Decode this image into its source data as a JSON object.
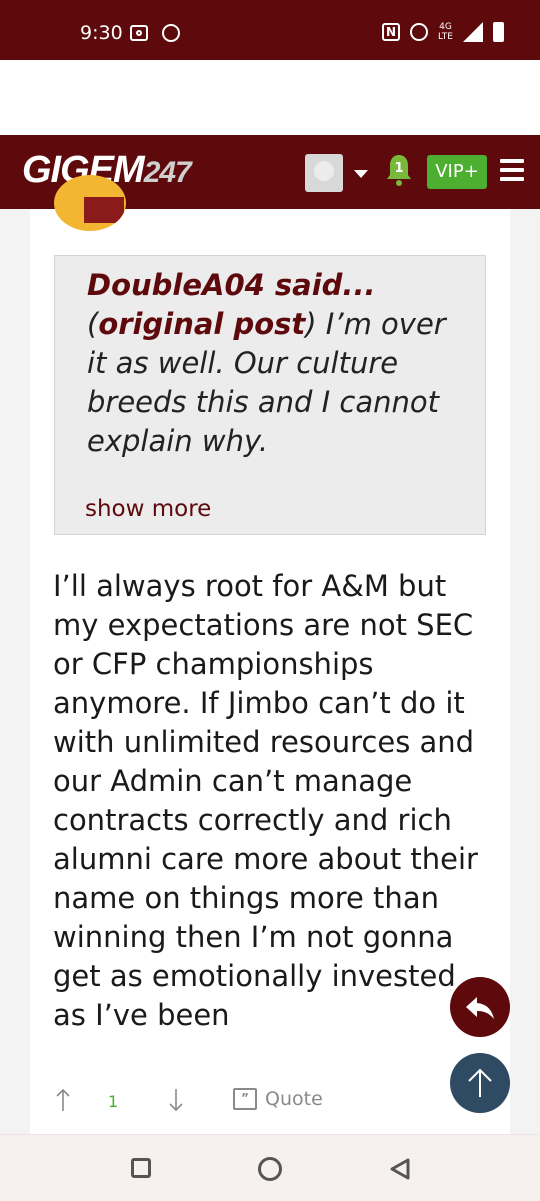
{
  "status_bar": {
    "time": "9:30",
    "network_label": "4G",
    "lte_label": "LTE",
    "icons": [
      "screen-record-icon",
      "chrome-icon",
      "nfc-icon",
      "alarm-icon",
      "data-arrows-icon",
      "signal-icon",
      "battery-icon"
    ]
  },
  "header": {
    "logo_text": "GIGEM",
    "logo_number": "247",
    "notification_count": "1",
    "vip_label": "VIP+",
    "brand_color": "#5e0a0d",
    "accent_color": "#4caf2f"
  },
  "quote": {
    "author": "DoubleA04 said...",
    "link_label": "original post",
    "text": " I’m over it as well. Our culture breeds this and I cannot explain why.",
    "show_more_label": "show more"
  },
  "post": {
    "body": "I’ll always root for A&M but my expectations are not SEC or CFP championships anymore. If Jimbo can’t do it with unlimited resources and our Admin can’t manage contracts correctly and rich alumni care more about their name on things more than winning then I’m not gonna get as emotionally invested as I’ve been",
    "vote_count": "1",
    "quote_label": "Quote"
  }
}
